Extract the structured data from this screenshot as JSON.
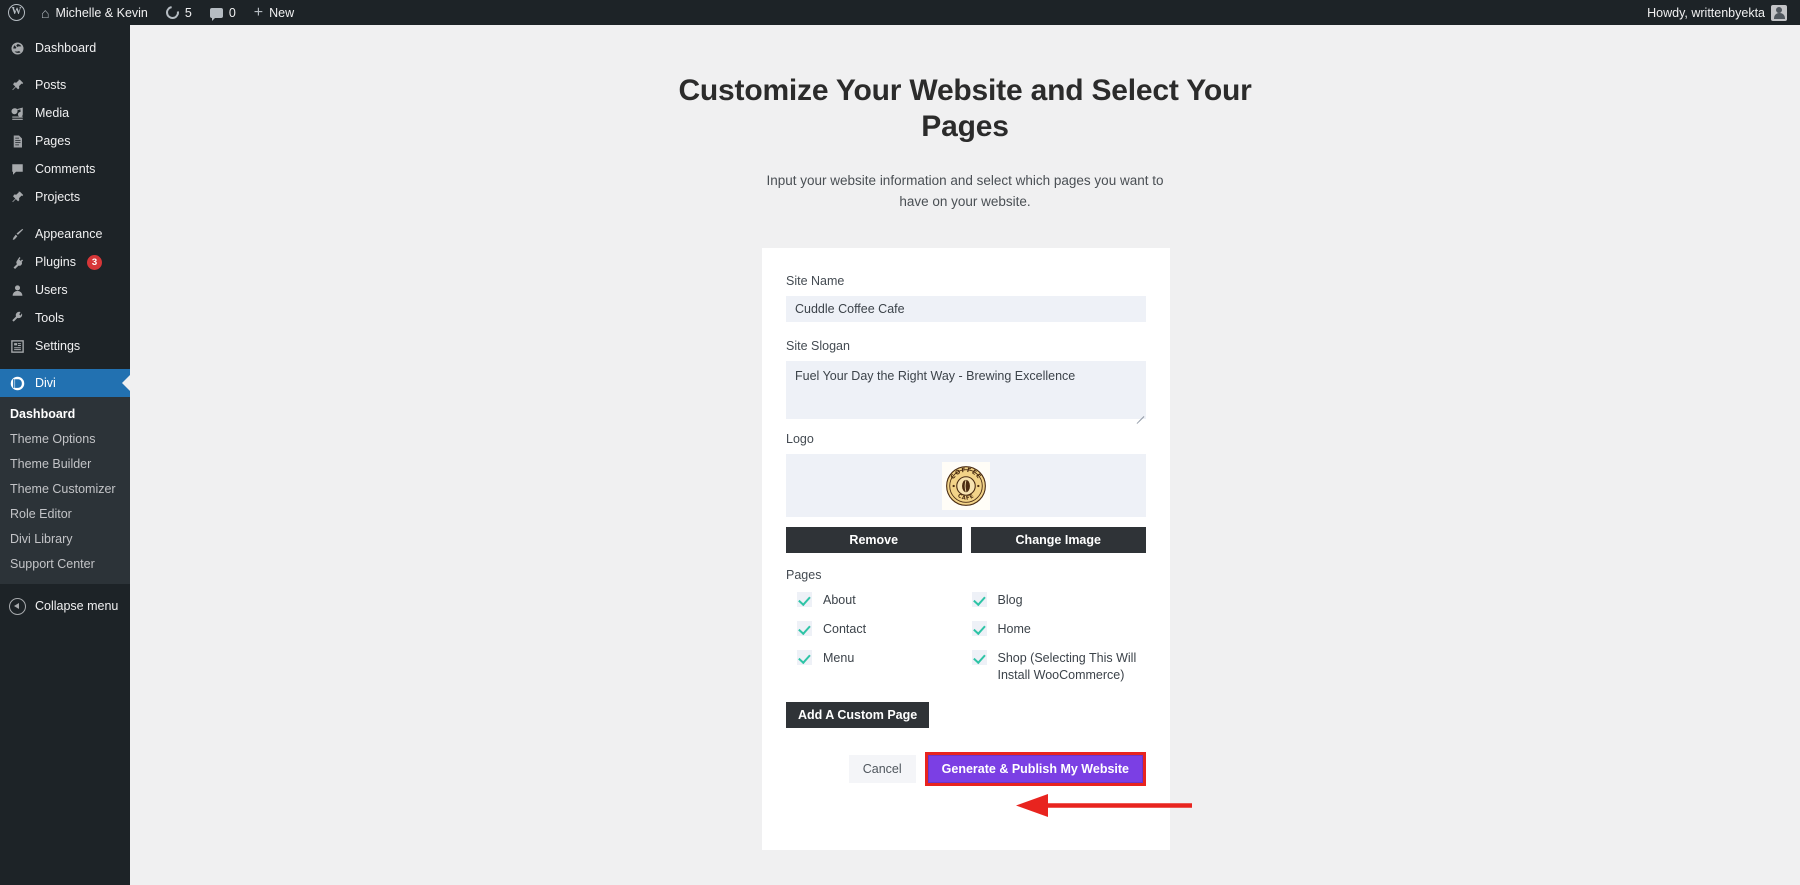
{
  "adminbar": {
    "wp_logo": "wordpress-logo",
    "site_name": "Michelle & Kevin",
    "updates_count": "5",
    "comments_count": "0",
    "new_label": "New",
    "howdy": "Howdy, writtenbyekta"
  },
  "sidebar": {
    "items": [
      {
        "label": "Dashboard",
        "icon": "dashboard-icon",
        "badge": ""
      },
      {
        "label": "Posts",
        "icon": "posts-pin-icon",
        "badge": ""
      },
      {
        "label": "Media",
        "icon": "media-icon",
        "badge": ""
      },
      {
        "label": "Pages",
        "icon": "pages-icon",
        "badge": ""
      },
      {
        "label": "Comments",
        "icon": "comments-icon",
        "badge": ""
      },
      {
        "label": "Projects",
        "icon": "projects-pin-icon",
        "badge": ""
      },
      {
        "label": "Appearance",
        "icon": "appearance-brush-icon",
        "badge": ""
      },
      {
        "label": "Plugins",
        "icon": "plugins-plug-icon",
        "badge": "3"
      },
      {
        "label": "Users",
        "icon": "users-icon",
        "badge": ""
      },
      {
        "label": "Tools",
        "icon": "tools-wrench-icon",
        "badge": ""
      },
      {
        "label": "Settings",
        "icon": "settings-sliders-icon",
        "badge": ""
      }
    ],
    "divi": {
      "label": "Divi",
      "icon": "divi-logo-icon"
    },
    "submenu": [
      {
        "label": "Dashboard",
        "current": true
      },
      {
        "label": "Theme Options",
        "current": false
      },
      {
        "label": "Theme Builder",
        "current": false
      },
      {
        "label": "Theme Customizer",
        "current": false
      },
      {
        "label": "Role Editor",
        "current": false
      },
      {
        "label": "Divi Library",
        "current": false
      },
      {
        "label": "Support Center",
        "current": false
      }
    ],
    "collapse_label": "Collapse menu",
    "active_color": "#2271b1",
    "badge_color": "#d63638"
  },
  "main": {
    "title": "Customize Your Website and Select Your Pages",
    "subtitle": "Input your website information and select which pages you want to have on your website.",
    "form": {
      "site_name_label": "Site Name",
      "site_name_value": "Cuddle Coffee Cafe",
      "site_name_placeholder": "Site Name",
      "site_slogan_label": "Site Slogan",
      "site_slogan_value": "Fuel Your Day the Right Way - Brewing Excellence",
      "site_slogan_placeholder": "Site Slogan",
      "logo_label": "Logo",
      "logo_alt": "coffee-cafe-badge-logo",
      "logo_top_text": "COFFEE",
      "logo_bottom_text": "CAFE",
      "remove_label": "Remove",
      "change_image_label": "Change Image",
      "pages_label": "Pages",
      "pages": [
        {
          "label": "About",
          "checked": true
        },
        {
          "label": "Blog",
          "checked": true
        },
        {
          "label": "Contact",
          "checked": true
        },
        {
          "label": "Home",
          "checked": true
        },
        {
          "label": "Menu",
          "checked": true
        },
        {
          "label": "Shop (Selecting This Will Install WooCommerce)",
          "checked": true
        }
      ],
      "add_custom_page_label": "Add A Custom Page",
      "cancel_label": "Cancel",
      "generate_label": "Generate & Publish My Website"
    }
  },
  "annotation": {
    "arrow": "red-left-arrow-pointing-to-generate-button",
    "highlight_color": "#e8241f",
    "primary_color": "#7b3fe4",
    "check_color": "#2ec4a6"
  }
}
